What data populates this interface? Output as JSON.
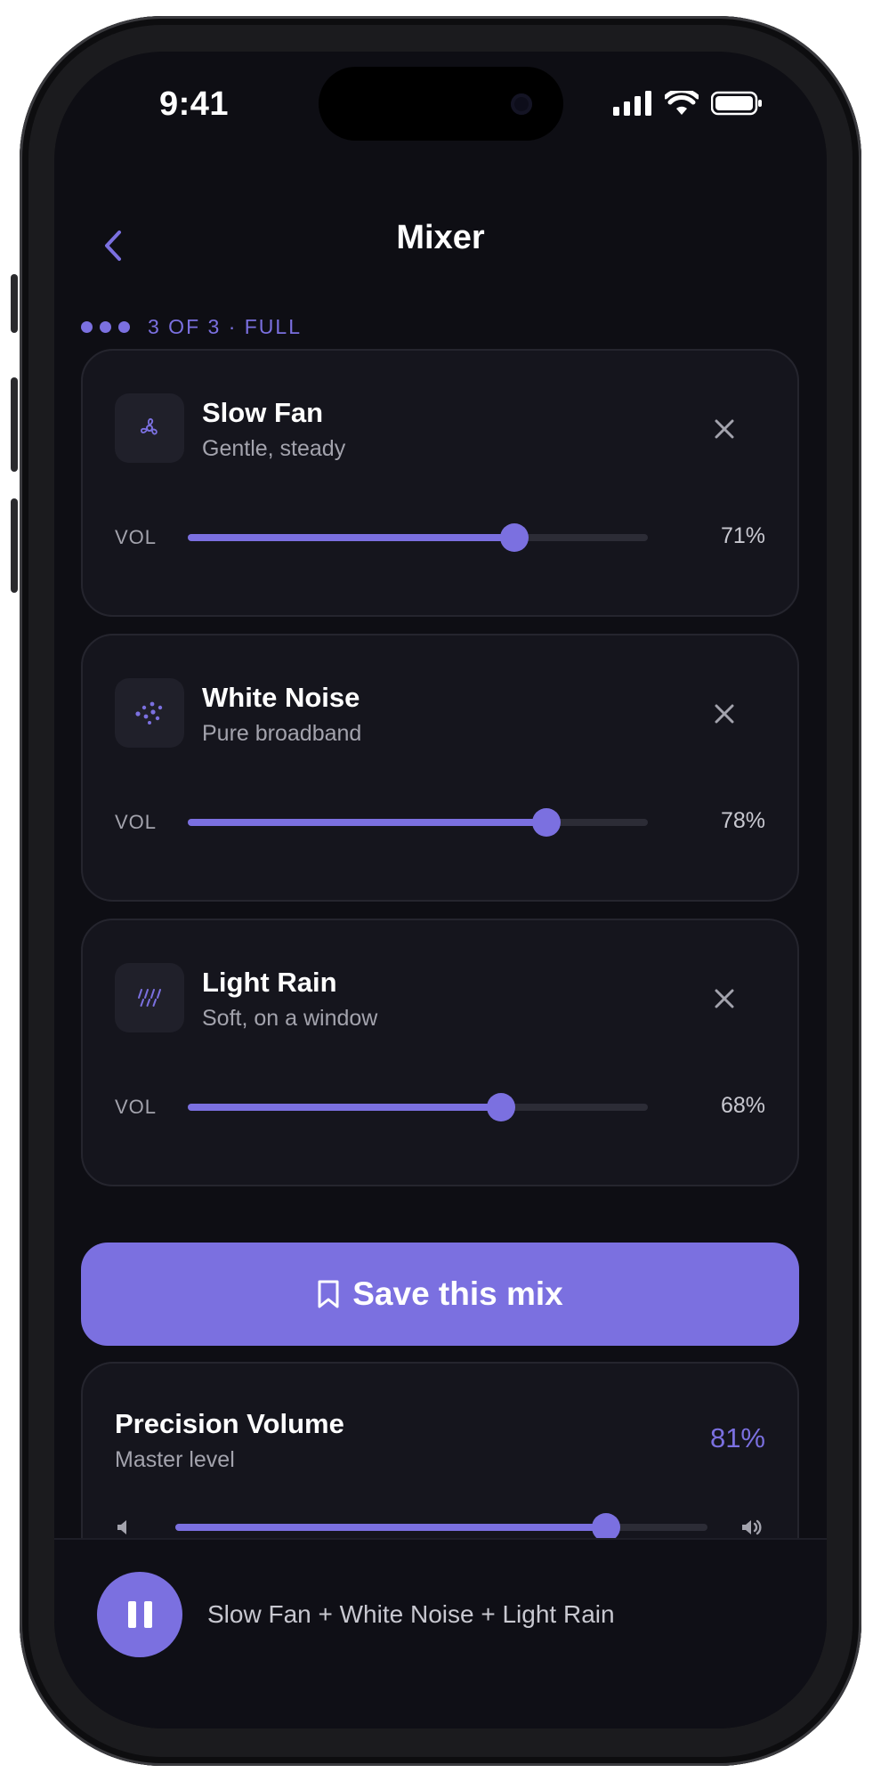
{
  "status_bar": {
    "time": "9:41"
  },
  "nav": {
    "title": "Mixer"
  },
  "capacity": {
    "label": "3 OF 3 · FULL",
    "filled": 3,
    "total": 3
  },
  "tracks": [
    {
      "name": "Slow Fan",
      "subtitle": "Gentle, steady",
      "vol_label": "VOL",
      "volume": 71,
      "volume_text": "71%",
      "icon": "fan-icon"
    },
    {
      "name": "White Noise",
      "subtitle": "Pure broadband",
      "vol_label": "VOL",
      "volume": 78,
      "volume_text": "78%",
      "icon": "noise-icon"
    },
    {
      "name": "Light Rain",
      "subtitle": "Soft, on a window",
      "vol_label": "VOL",
      "volume": 68,
      "volume_text": "68%",
      "icon": "rain-icon"
    }
  ],
  "save_button": {
    "label": "Save this mix"
  },
  "master": {
    "title": "Precision Volume",
    "subtitle": "Master level",
    "volume": 81,
    "volume_text": "81%"
  },
  "now_playing": {
    "text": "Slow Fan + White Noise + Light Rain"
  },
  "colors": {
    "accent": "#7b70e0",
    "background": "#0e0e14",
    "card": "#15151d"
  }
}
